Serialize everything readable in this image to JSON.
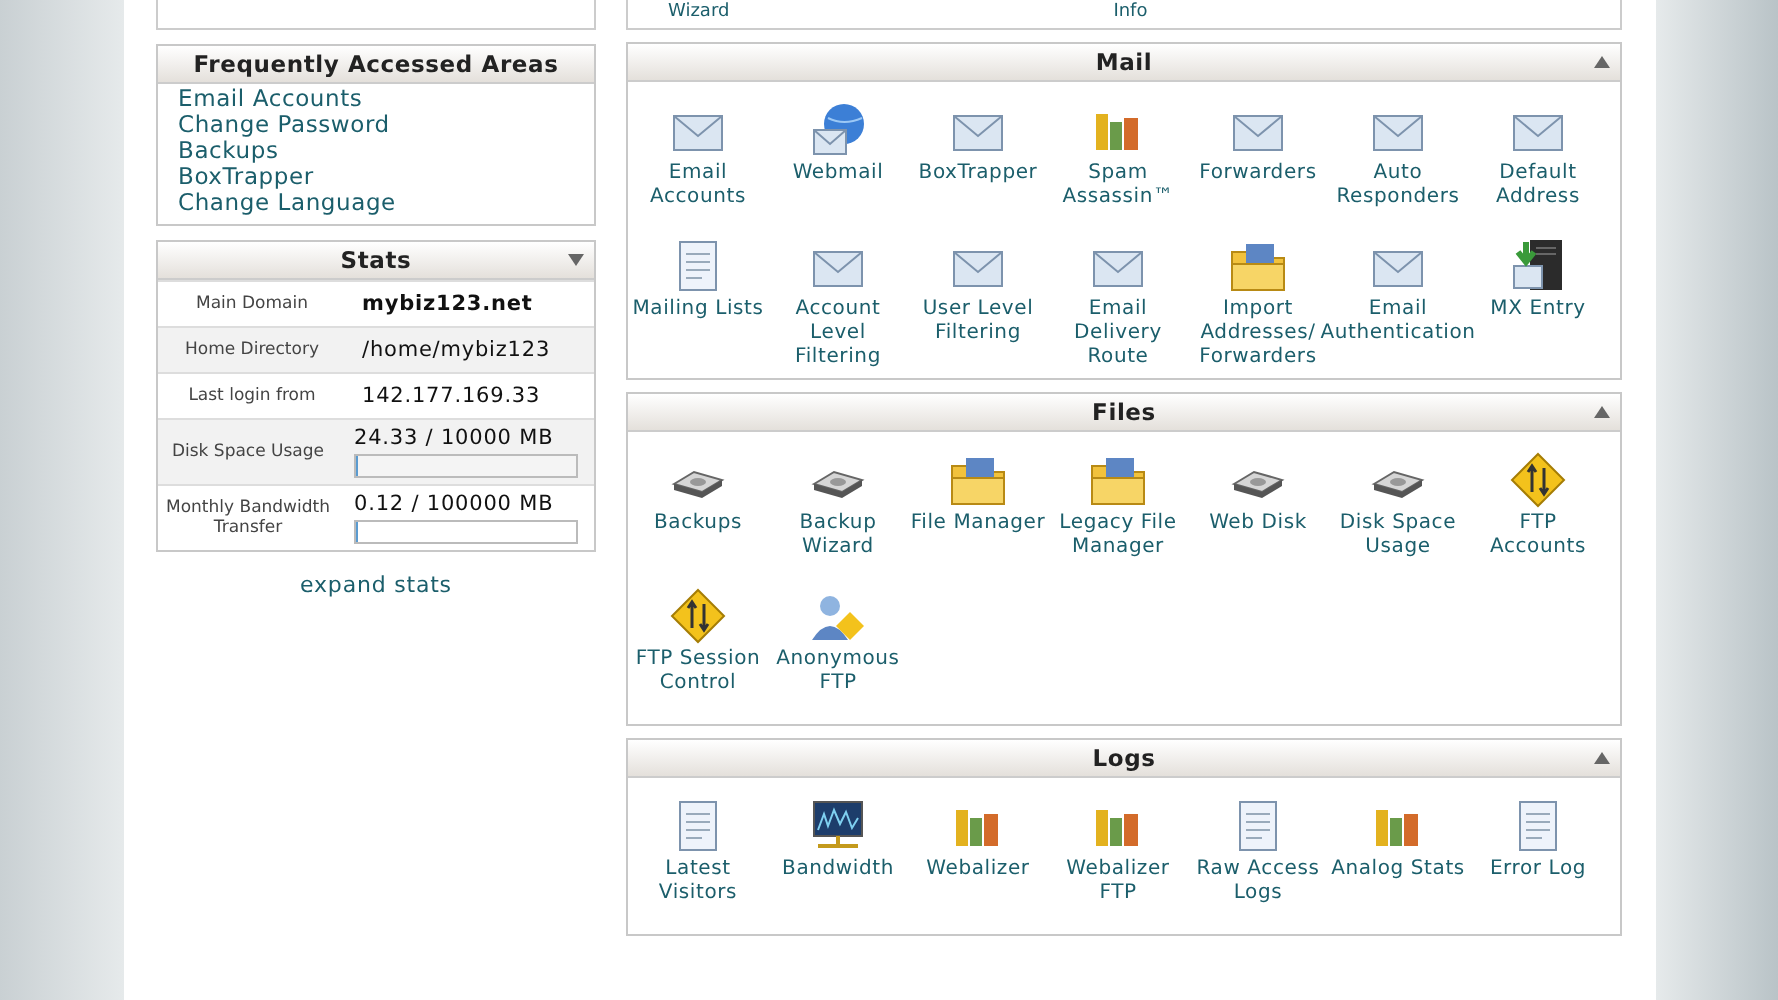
{
  "top_section": {
    "items": [
      {
        "label": "Wizard"
      },
      {
        "label": "Info"
      }
    ]
  },
  "frequently_accessed": {
    "title": "Frequently Accessed Areas",
    "links": [
      "Email Accounts",
      "Change Password",
      "Backups",
      "BoxTrapper",
      "Change Language"
    ]
  },
  "stats": {
    "title": "Stats",
    "rows": [
      {
        "label": "Main Domain",
        "value": "mybiz123.net",
        "bold": true
      },
      {
        "label": "Home Directory",
        "value": "/home/mybiz123",
        "bold": false
      },
      {
        "label": "Last login from",
        "value": "142.177.169.33",
        "bold": false
      },
      {
        "label": "Disk Space Usage",
        "value": "24.33 / 10000 MB",
        "bold": false,
        "level": 0.0024
      },
      {
        "label": "Monthly Bandwidth Transfer",
        "value": "0.12 / 100000 MB",
        "bold": false,
        "level": 1e-06
      }
    ],
    "expand_link": "expand stats"
  },
  "sections": [
    {
      "title": "Mail",
      "items": [
        {
          "label": "Email Accounts"
        },
        {
          "label": "Webmail"
        },
        {
          "label": "BoxTrapper"
        },
        {
          "label": "Spam Assassin™"
        },
        {
          "label": "Forwarders"
        },
        {
          "label": "Auto Responders"
        },
        {
          "label": "Default Address"
        },
        {
          "label": "Mailing Lists"
        },
        {
          "label": "Account Level Filtering"
        },
        {
          "label": "User Level Filtering"
        },
        {
          "label": "Email Delivery Route"
        },
        {
          "label": "Import Addresses/ Forwarders"
        },
        {
          "label": "Email Authentication"
        },
        {
          "label": "MX Entry"
        }
      ]
    },
    {
      "title": "Files",
      "items": [
        {
          "label": "Backups"
        },
        {
          "label": "Backup Wizard"
        },
        {
          "label": "File Manager"
        },
        {
          "label": "Legacy File Manager"
        },
        {
          "label": "Web Disk"
        },
        {
          "label": "Disk Space Usage"
        },
        {
          "label": "FTP Accounts"
        },
        {
          "label": "FTP Session Control"
        },
        {
          "label": "Anonymous FTP"
        }
      ]
    },
    {
      "title": "Logs",
      "items": [
        {
          "label": "Latest Visitors"
        },
        {
          "label": "Bandwidth"
        },
        {
          "label": "Webalizer"
        },
        {
          "label": "Webalizer FTP"
        },
        {
          "label": "Raw Access Logs"
        },
        {
          "label": "Analog Stats"
        },
        {
          "label": "Error Log"
        }
      ]
    }
  ]
}
